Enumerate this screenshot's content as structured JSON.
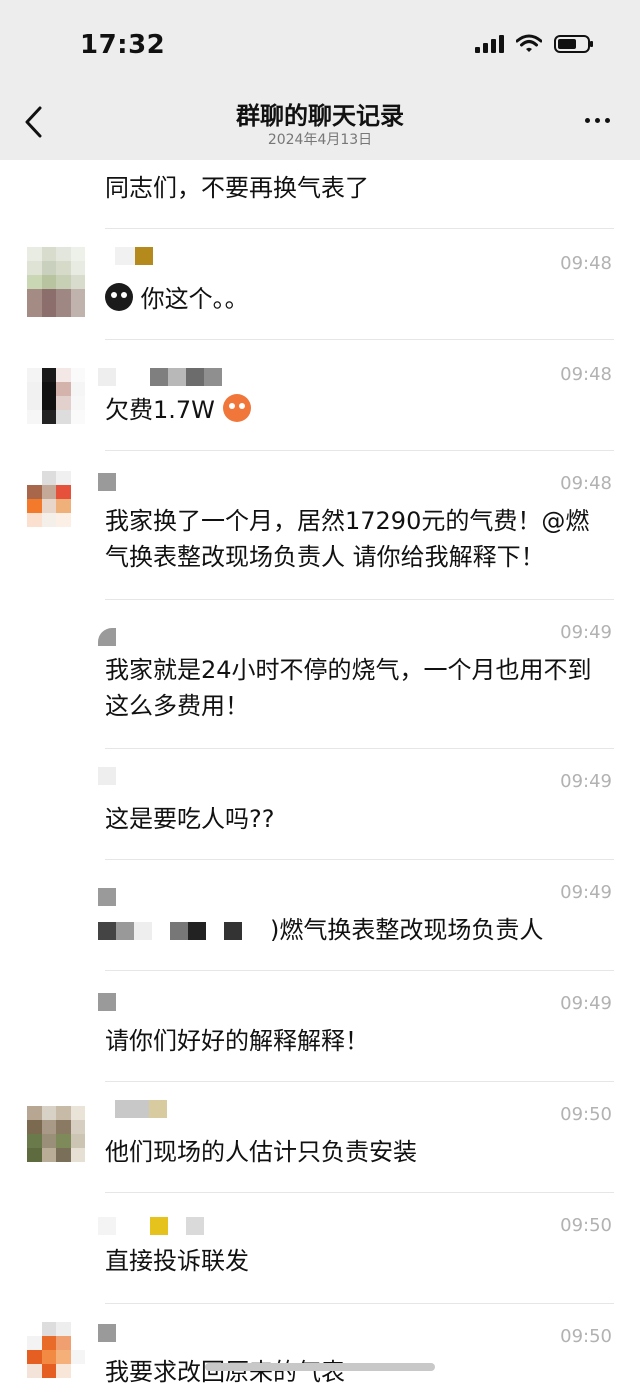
{
  "status_bar": {
    "time": "17:32"
  },
  "header": {
    "title": "群聊的聊天记录",
    "subtitle": "2024年4月13日"
  },
  "messages": [
    {
      "text": "同志们，不要再换气表了"
    },
    {
      "time": "09:48",
      "text": "你这个。。"
    },
    {
      "time": "09:48",
      "text": "欠费1.7W"
    },
    {
      "time": "09:48",
      "text": "我家换了一个月，居然17290元的气费！@燃气换表整改现场负责人 请你给我解释下！"
    },
    {
      "time": "09:49",
      "text": "我家就是24小时不停的烧气，一个月也用不到这么多费用！"
    },
    {
      "time": "09:49",
      "text": "这是要吃人吗??"
    },
    {
      "time": "09:49",
      "text": ")燃气换表整改现场负责人"
    },
    {
      "time": "09:49",
      "text": "请你们好好的解释解释！"
    },
    {
      "time": "09:50",
      "text": "他们现场的人估计只负责安装"
    },
    {
      "time": "09:50",
      "text": "直接投诉联发"
    },
    {
      "time": "09:50",
      "text": "我要求改回原来的气表"
    }
  ],
  "icons": {
    "back": "chevron-left-icon",
    "more": "more-dots-icon",
    "signal": "cell-signal-icon",
    "wifi": "wifi-icon",
    "battery": "battery-icon"
  }
}
